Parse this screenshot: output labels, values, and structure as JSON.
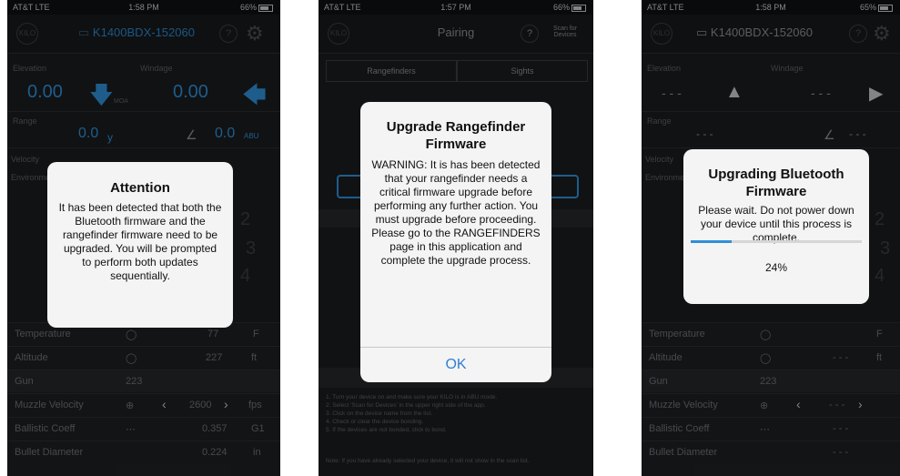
{
  "colors": {
    "accent": "#2f8fd6",
    "background": "#1b1d20",
    "modal": "#f4f4f4"
  },
  "left": {
    "status": {
      "carrier": "AT&T LTE",
      "time": "1:58 PM",
      "battery": "66%"
    },
    "nav": {
      "device": "K1400BDX-152060",
      "back_icon": "back-circle-icon",
      "help": "?",
      "settings_icon": "gear-icon"
    },
    "elevation": {
      "label": "Elevation",
      "value": "0.00",
      "unit": "MOA"
    },
    "windage": {
      "label": "Windage",
      "value": "0.00"
    },
    "range": {
      "label": "Range",
      "value": "0.0",
      "unit": "y"
    },
    "angle": {
      "value": "0.0",
      "unit": "ABU"
    },
    "velocity_label": "Velocity",
    "env_label": "Environment",
    "side_numbers": [
      "2",
      "3",
      "4"
    ],
    "table": [
      {
        "name": "Temperature",
        "value": "77",
        "unit": "F"
      },
      {
        "name": "Altitude",
        "value": "227",
        "unit": "ft"
      },
      {
        "name": "Gun",
        "value": "223",
        "unit": ""
      },
      {
        "name": "Muzzle Velocity",
        "value": "2600",
        "unit": "fps"
      },
      {
        "name": "Ballistic Coeff",
        "value": "0.357",
        "unit": "G1"
      },
      {
        "name": "Bullet Diameter",
        "value": "0.224",
        "unit": "in"
      }
    ],
    "modal": {
      "title": "Attention",
      "body": "It has been detected that both the Bluetooth firmware and the rangefinder firmware need to be upgraded.  You will be prompted to perform both updates sequentially."
    }
  },
  "middle": {
    "status": {
      "carrier": "AT&T LTE",
      "time": "1:57 PM",
      "battery": "66%"
    },
    "nav": {
      "title": "Pairing",
      "scan": "Scan for Devices"
    },
    "tabs": [
      "Rangefinders",
      "Sights"
    ],
    "instructions": "1. Turn your device on and make sure your KILO is in ABU mode.\n2. Select 'Scan for Devices' in the upper right side of the app.\n3. Click on the device name from the list.\n4. Check or clear the device bonding.\n5. If the devices are not bonded, click to bond.",
    "note": "Note: If you have already selected your device, it will not show in the scan list.",
    "modal": {
      "title": "Upgrade Rangefinder Firmware",
      "body": "WARNING: It is has been detected that your rangefinder needs a critical firmware upgrade before performing any further action.  You must upgrade before proceeding.  Please go to the RANGEFINDERS page in this application and complete the upgrade process.",
      "ok": "OK"
    }
  },
  "right": {
    "status": {
      "carrier": "AT&T LTE",
      "time": "1:58 PM",
      "battery": "65%"
    },
    "nav": {
      "device": "K1400BDX-152060"
    },
    "elevation": {
      "label": "Elevation",
      "value": "- - -"
    },
    "windage": {
      "label": "Windage",
      "value": "- - -"
    },
    "range": {
      "label": "Range",
      "value": "- - -"
    },
    "angle": {
      "value": "- - -"
    },
    "velocity_label": "Velocity",
    "env_label": "Environment",
    "side_numbers": [
      "2",
      "3",
      "4"
    ],
    "table": [
      {
        "name": "Temperature",
        "value": "",
        "unit": "F"
      },
      {
        "name": "Altitude",
        "value": "- - -",
        "unit": "ft"
      },
      {
        "name": "Gun",
        "value": "223",
        "unit": ""
      },
      {
        "name": "Muzzle Velocity",
        "value": "- - -",
        "unit": ""
      },
      {
        "name": "Ballistic Coeff",
        "value": "- - -",
        "unit": ""
      },
      {
        "name": "Bullet Diameter",
        "value": "- - -",
        "unit": ""
      }
    ],
    "modal": {
      "title": "Upgrading Bluetooth Firmware",
      "body": "Please wait.  Do not power down your device until this process is complete.",
      "progress": "24%",
      "progress_fraction": 0.24
    }
  }
}
